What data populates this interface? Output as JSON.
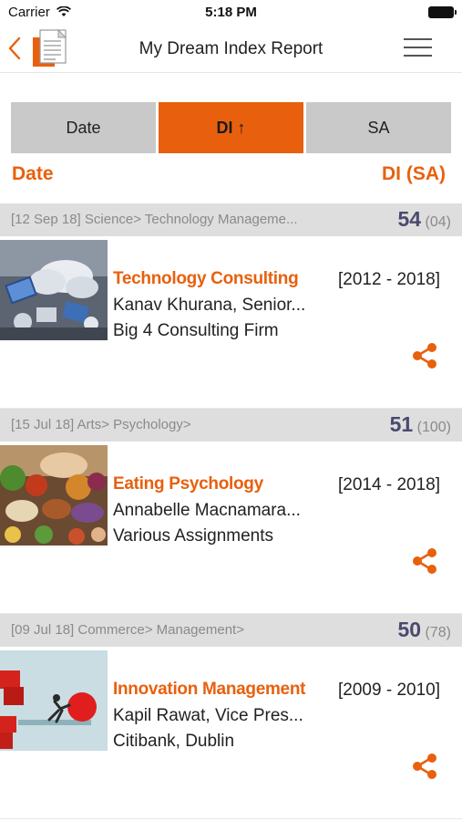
{
  "status_bar": {
    "carrier": "Carrier",
    "time": "5:18 PM"
  },
  "nav": {
    "title": "My Dream Index Report"
  },
  "sort_tabs": [
    {
      "label": "Date",
      "active": false
    },
    {
      "label": "DI ↑",
      "active": true
    },
    {
      "label": "SA",
      "active": false
    }
  ],
  "list_header": {
    "left": "Date",
    "right": "DI (SA)"
  },
  "entries": [
    {
      "breadcrumb": "[12 Sep 18] Science> Technology Manageme...",
      "score": "54",
      "sa": "(04)",
      "title": "Technology Consulting",
      "years": "[2012 - 2018]",
      "person": "Kanav Khurana, Senior...",
      "org": "Big 4 Consulting Firm"
    },
    {
      "breadcrumb": "[15 Jul 18] Arts> Psychology>",
      "score": "51",
      "sa": "(100)",
      "title": "Eating Psychology",
      "years": "[2014 - 2018]",
      "person": "Annabelle Macnamara...",
      "org": "Various Assignments"
    },
    {
      "breadcrumb": "[09 Jul 18] Commerce> Management>",
      "score": "50",
      "sa": "(78)",
      "title": "Innovation Management",
      "years": "[2009 - 2010]",
      "person": "Kapil Rawat, Vice Pres...",
      "org": "Citibank, Dublin"
    }
  ],
  "colors": {
    "accent": "#e8600d",
    "score": "#4a4a6e",
    "tab_inactive": "#c9c9c9",
    "card_header": "#dedede"
  }
}
